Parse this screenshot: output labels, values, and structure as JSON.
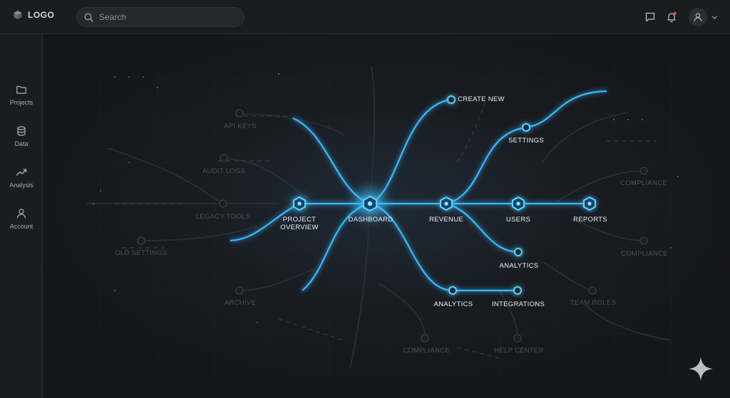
{
  "header": {
    "logo_text": "LOGO",
    "search_placeholder": "Search",
    "icons": [
      "cube-icon",
      "search-icon",
      "chat-icon",
      "bell-icon",
      "user-icon",
      "chevron-down-icon"
    ],
    "notification_dot_color": "#e0533c"
  },
  "sidebar": {
    "items": [
      {
        "label": "Projects",
        "icon": "folder-icon"
      },
      {
        "label": "Data",
        "icon": "database-icon"
      },
      {
        "label": "Analysis",
        "icon": "trend-icon"
      },
      {
        "label": "Account",
        "icon": "user-icon"
      }
    ]
  },
  "map": {
    "accent_color": "#3bb6ff",
    "active_nodes": [
      {
        "id": "project-overview",
        "label": "PROJECT\nOVERVIEW"
      },
      {
        "id": "dashboard",
        "label": "DASHBOARD"
      },
      {
        "id": "revenue",
        "label": "REVENUE"
      },
      {
        "id": "users",
        "label": "USERS"
      },
      {
        "id": "reports",
        "label": "REPORTS"
      },
      {
        "id": "create-new",
        "label": "CREATE NEW"
      },
      {
        "id": "settings",
        "label": "SETTINGS"
      },
      {
        "id": "analytics-right",
        "label": "ANALYTICS"
      },
      {
        "id": "analytics-bottom",
        "label": "ANALYTICS"
      },
      {
        "id": "integrations",
        "label": "INTEGRATIONS"
      }
    ],
    "faded_labels": [
      {
        "id": "api-keys",
        "label": "API KEYS"
      },
      {
        "id": "audit-logs",
        "label": "AUDIT LOGS"
      },
      {
        "id": "legacy-tools",
        "label": "LEGACY TOOLS"
      },
      {
        "id": "old-settings",
        "label": "OLD SETTINGS"
      },
      {
        "id": "archive",
        "label": "ARCHIVE"
      },
      {
        "id": "compliance-top",
        "label": "COMPLIANCE"
      },
      {
        "id": "compliance-mid",
        "label": "COMPLIANCE"
      },
      {
        "id": "team-roles",
        "label": "TEAM ROLES"
      },
      {
        "id": "compliance-bottom",
        "label": "COMPLIANCE"
      },
      {
        "id": "help-center",
        "label": "HELP CENTER"
      }
    ]
  },
  "assistant": {
    "icon": "sparkle-icon"
  }
}
